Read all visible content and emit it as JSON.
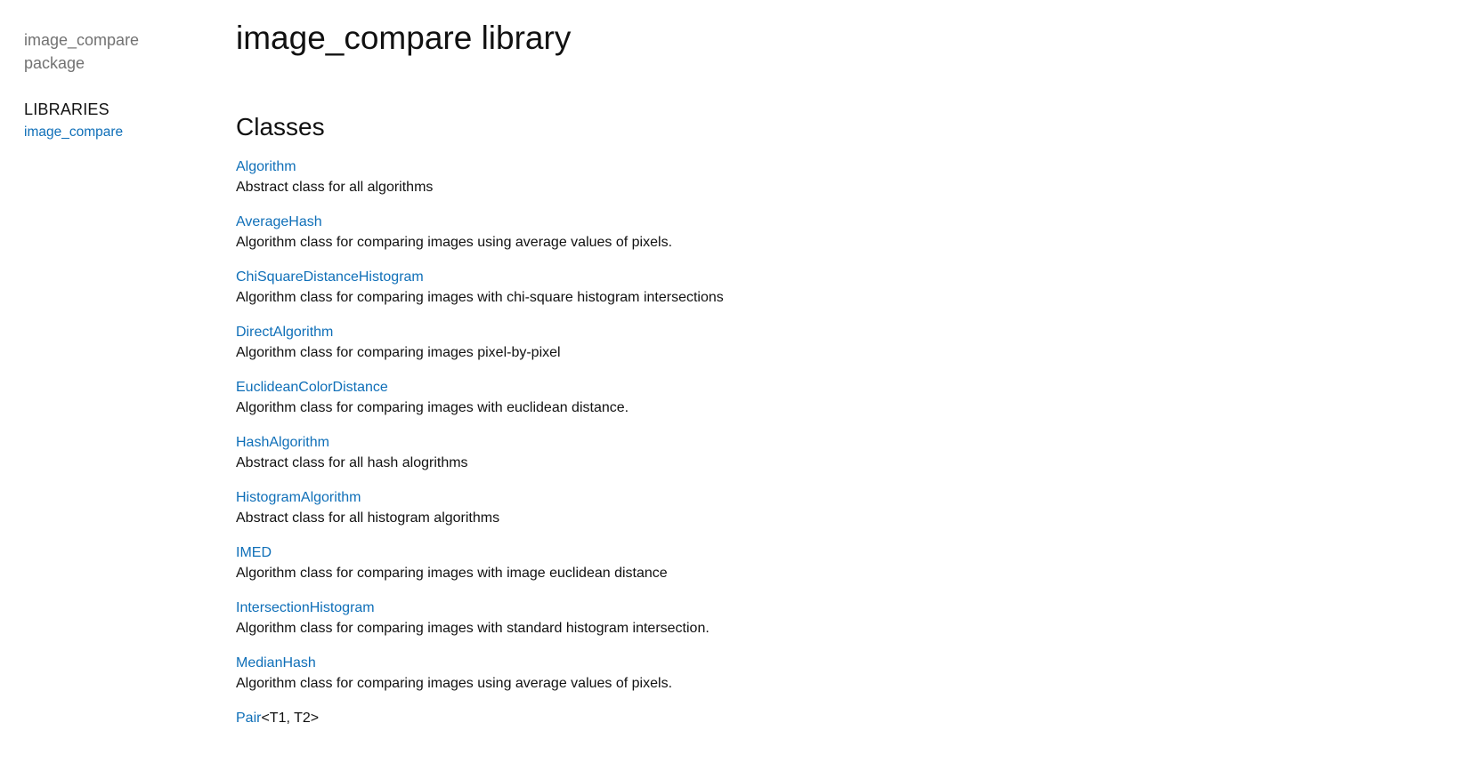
{
  "sidebar": {
    "package_name": "image_compare package",
    "libraries_heading": "LIBRARIES",
    "library_link": "image_compare"
  },
  "main": {
    "title": "image_compare library",
    "section_title": "Classes",
    "classes": [
      {
        "name": "Algorithm",
        "description": "Abstract class for all algorithms"
      },
      {
        "name": "AverageHash",
        "description": "Algorithm class for comparing images using average values of pixels."
      },
      {
        "name": "ChiSquareDistanceHistogram",
        "description": "Algorithm class for comparing images with chi-square histogram intersections"
      },
      {
        "name": "DirectAlgorithm",
        "description": "Algorithm class for comparing images pixel-by-pixel"
      },
      {
        "name": "EuclideanColorDistance",
        "description": "Algorithm class for comparing images with euclidean distance."
      },
      {
        "name": "HashAlgorithm",
        "description": "Abstract class for all hash alogrithms"
      },
      {
        "name": "HistogramAlgorithm",
        "description": "Abstract class for all histogram algorithms"
      },
      {
        "name": "IMED",
        "description": "Algorithm class for comparing images with image euclidean distance"
      },
      {
        "name": "IntersectionHistogram",
        "description": "Algorithm class for comparing images with standard histogram intersection."
      },
      {
        "name": "MedianHash",
        "description": "Algorithm class for comparing images using average values of pixels."
      },
      {
        "name": "Pair",
        "type_params": "<T1, T2>",
        "description": ""
      }
    ]
  }
}
